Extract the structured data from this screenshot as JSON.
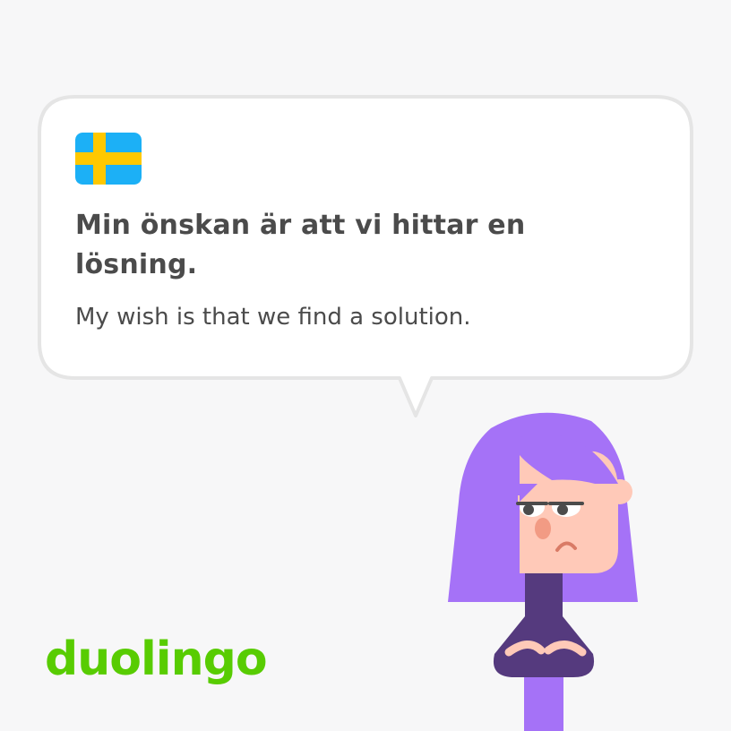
{
  "card": {
    "language_flag": "swedish-flag-icon",
    "sentence": "Min önskan är att vi hittar en lösning.",
    "translation": "My wish is that we find a solution."
  },
  "brand": {
    "logo_text": "duolingo"
  },
  "character": {
    "icon": "lily-character-icon"
  },
  "colors": {
    "background": "#f7f7f8",
    "bubble_fill": "#ffffff",
    "bubble_border": "#e5e5e5",
    "text": "#4b4b4b",
    "brand_green": "#58cc02",
    "flag_blue": "#1cb0f6",
    "flag_yellow": "#ffc800",
    "hair": "#a572f7",
    "skin": "#ffc9b8",
    "shirt": "#553a7e"
  }
}
